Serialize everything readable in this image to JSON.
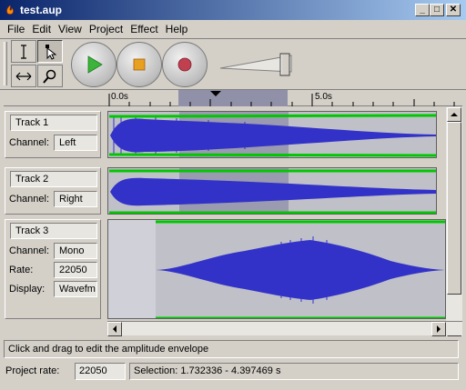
{
  "window": {
    "title": "test.aup",
    "min_label": "_",
    "max_label": "□",
    "close_label": "✕"
  },
  "menu": [
    {
      "label": "File"
    },
    {
      "label": "Edit"
    },
    {
      "label": "View"
    },
    {
      "label": "Project"
    },
    {
      "label": "Effect"
    },
    {
      "label": "Help"
    }
  ],
  "ruler": {
    "mark0": "0.0s",
    "mark1": "5.0s"
  },
  "tracks": [
    {
      "name": "Track 1",
      "channel_label": "Channel:",
      "channel": "Left"
    },
    {
      "name": "Track 2",
      "channel_label": "Channel:",
      "channel": "Right"
    },
    {
      "name": "Track 3",
      "channel_label": "Channel:",
      "channel": "Mono",
      "rate_label": "Rate:",
      "rate": "22050",
      "display_label": "Display:",
      "display": "Wavefm"
    }
  ],
  "status": {
    "message": "Click and drag to edit the amplitude envelope"
  },
  "bottom": {
    "project_rate_label": "Project rate:",
    "project_rate": "22050",
    "selection": "Selection: 1.732336 - 4.397469 s"
  },
  "colors": {
    "title_start": "#0a246a",
    "title_end": "#a6caf0",
    "wave": "#3232c8",
    "envelope": "#00c800",
    "selection": "#9090a8"
  }
}
